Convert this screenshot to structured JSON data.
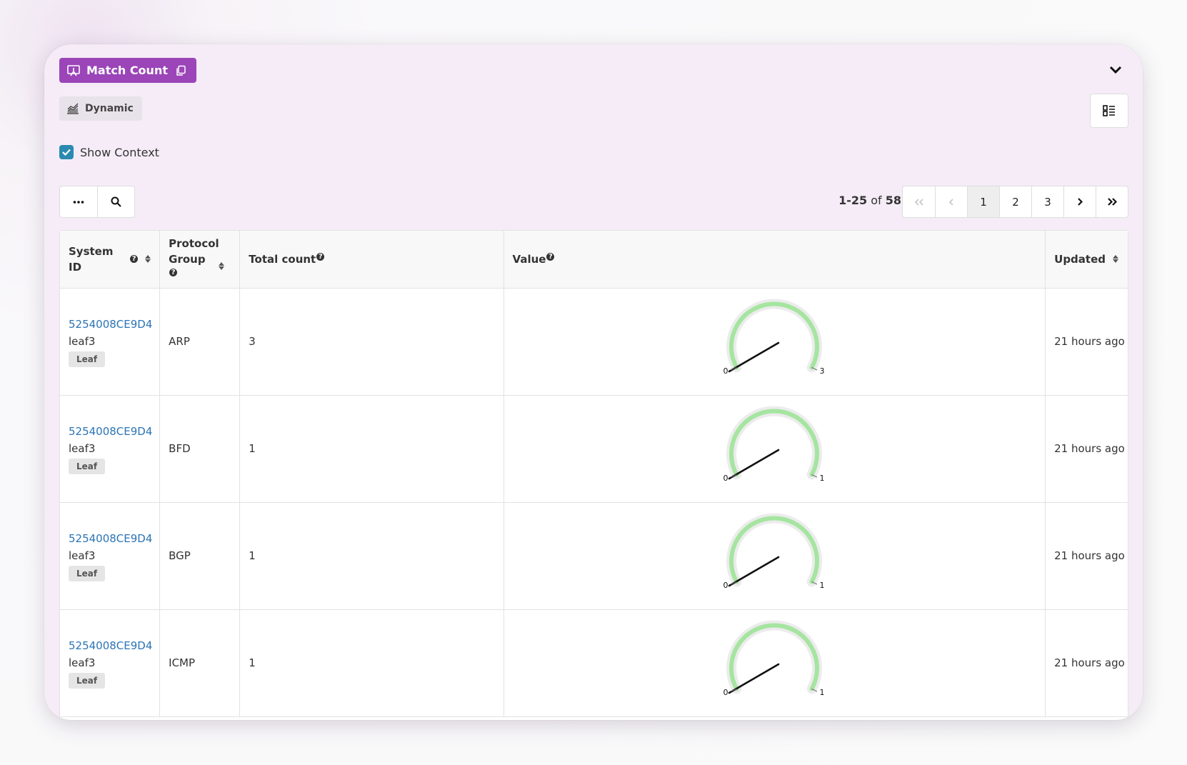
{
  "header": {
    "title": "Match Count",
    "mode_label": "Dynamic",
    "show_context_label": "Show Context",
    "show_context_checked": true
  },
  "pagination": {
    "range": "1-25",
    "of_label": "of",
    "total": "58",
    "pages": [
      "1",
      "2",
      "3"
    ],
    "current_page": "1"
  },
  "table": {
    "columns": {
      "system_id": "System ID",
      "protocol_group": "Protocol Group",
      "total_count": "Total count",
      "value": "Value",
      "updated": "Updated"
    },
    "rows": [
      {
        "system_id": "5254008CE9D4",
        "name": "leaf3",
        "role": "Leaf",
        "protocol": "ARP",
        "count": "3",
        "gauge_min": "0",
        "gauge_max": "3",
        "updated": "21 hours ago"
      },
      {
        "system_id": "5254008CE9D4",
        "name": "leaf3",
        "role": "Leaf",
        "protocol": "BFD",
        "count": "1",
        "gauge_min": "0",
        "gauge_max": "1",
        "updated": "21 hours ago"
      },
      {
        "system_id": "5254008CE9D4",
        "name": "leaf3",
        "role": "Leaf",
        "protocol": "BGP",
        "count": "1",
        "gauge_min": "0",
        "gauge_max": "1",
        "updated": "21 hours ago"
      },
      {
        "system_id": "5254008CE9D4",
        "name": "leaf3",
        "role": "Leaf",
        "protocol": "ICMP",
        "count": "1",
        "gauge_min": "0",
        "gauge_max": "1",
        "updated": "21 hours ago"
      }
    ]
  },
  "colors": {
    "accent": "#9b45b8",
    "card_bg": "#f5ecf7",
    "link": "#2b74b5",
    "gauge_fill": "#a5e5a0",
    "gauge_track": "#e8e8e8",
    "checkbox": "#2a8ab0"
  }
}
